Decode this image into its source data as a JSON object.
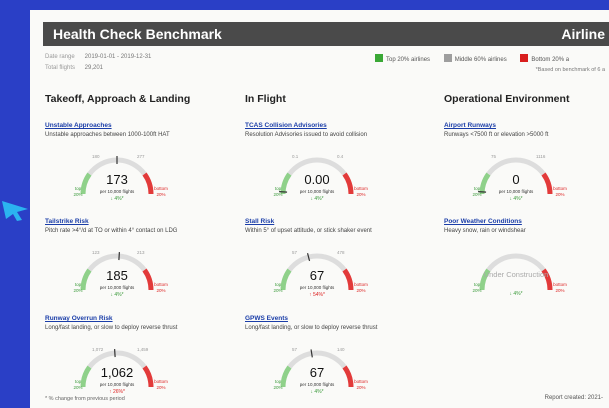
{
  "header": {
    "title": "Health Check Benchmark",
    "brand": "Airline"
  },
  "meta": [
    {
      "key": "Date range",
      "value": "2019-01-01 - 2019-12-31"
    },
    {
      "key": "Total flights",
      "value": "29,201"
    }
  ],
  "legend": [
    {
      "label": "Top 20% airlines",
      "color": "#3aa836"
    },
    {
      "label": "Middle 60% airlines",
      "color": "#9e9e9e"
    },
    {
      "label": "Bottom 20% a",
      "color": "#d91e1e"
    }
  ],
  "benchmark_note": "*Based on benchmark of 6 a",
  "columns": [
    {
      "title": "Takeoff, Approach & Landing",
      "metrics": [
        {
          "name": "Unstable Approaches",
          "desc": "Unstable approaches between 1000-100ft HAT",
          "value": "173",
          "unit": "per 10,000 flights",
          "change": "↓ 4%*",
          "dir": "down",
          "top_label": "top",
          "top_pct": "20%",
          "bottom_label": "bottom",
          "bottom_pct": "20%",
          "tick_low": "180",
          "tick_high": "277",
          "level": 0.5
        },
        {
          "name": "Tailstrike Risk",
          "desc": "Pitch rate >4°/d at TO or within 4° contact on LDG",
          "value": "185",
          "unit": "per 10,000 flights",
          "change": "↓ 4%*",
          "dir": "down",
          "top_label": "top",
          "top_pct": "20%",
          "bottom_label": "bottom",
          "bottom_pct": "20%",
          "tick_low": "123",
          "tick_high": "213",
          "level": 0.52
        },
        {
          "name": "Runway Overrun Risk",
          "desc": "Long/fast landing, or slow to deploy reverse thrust",
          "value": "1,062",
          "unit": "per 10,000 flights",
          "change": "↑ 26%*",
          "dir": "up",
          "top_label": "top",
          "top_pct": "20%",
          "bottom_label": "bottom",
          "bottom_pct": "20%",
          "tick_low": "1,072",
          "tick_high": "1,459",
          "level": 0.48
        }
      ]
    },
    {
      "title": "In Flight",
      "metrics": [
        {
          "name": "TCAS Collision Advisories",
          "desc": "Resolution Advisories issued to avoid collision",
          "value": "0.00",
          "unit": "per 10,000 flights",
          "change": "↓ 4%*",
          "dir": "down",
          "top_label": "top",
          "top_pct": "20%",
          "bottom_label": "bottom",
          "bottom_pct": "20%",
          "tick_low": "0.1",
          "tick_high": "0.4",
          "level": 0.02
        },
        {
          "name": "Stall Risk",
          "desc": "Within 5° of upset attitude, or stick shaker event",
          "value": "67",
          "unit": "per 10,000 flights",
          "change": "↑ 54%*",
          "dir": "up",
          "top_label": "top",
          "top_pct": "20%",
          "bottom_label": "bottom",
          "bottom_pct": "20%",
          "tick_low": "57",
          "tick_high": "478",
          "level": 0.42
        },
        {
          "name": "GPWS Events",
          "desc": "Long/fast landing, or slow to deploy reverse thrust",
          "value": "67",
          "unit": "per 10,000 flights",
          "change": "↓ 4%*",
          "dir": "down",
          "top_label": "top",
          "top_pct": "20%",
          "bottom_label": "bottom",
          "bottom_pct": "20%",
          "tick_low": "57",
          "tick_high": "140",
          "level": 0.45
        }
      ]
    },
    {
      "title": "Operational Environment",
      "metrics": [
        {
          "name": "Airport Runways",
          "desc": "Runways <7500 ft or elevation >5000 ft",
          "value": "0",
          "unit": "per 10,000 flights",
          "change": "↓ 4%*",
          "dir": "down",
          "top_label": "top",
          "top_pct": "20%",
          "bottom_label": "bottom",
          "bottom_pct": "20%",
          "tick_low": "75",
          "tick_high": "1116",
          "level": 0.02
        },
        {
          "name": "Poor Weather Conditions",
          "desc": "Heavy snow, rain or windshear",
          "value": "Under Construction",
          "unit": "",
          "change": "↓ 4%*",
          "dir": "down",
          "top_label": "top",
          "top_pct": "20%",
          "bottom_label": "bottom",
          "bottom_pct": "20%",
          "tick_low": "",
          "tick_high": "",
          "level": null,
          "under_construction": true
        }
      ]
    }
  ],
  "footnote": "* % change from previous period",
  "report_created": "Report created: 2021-"
}
